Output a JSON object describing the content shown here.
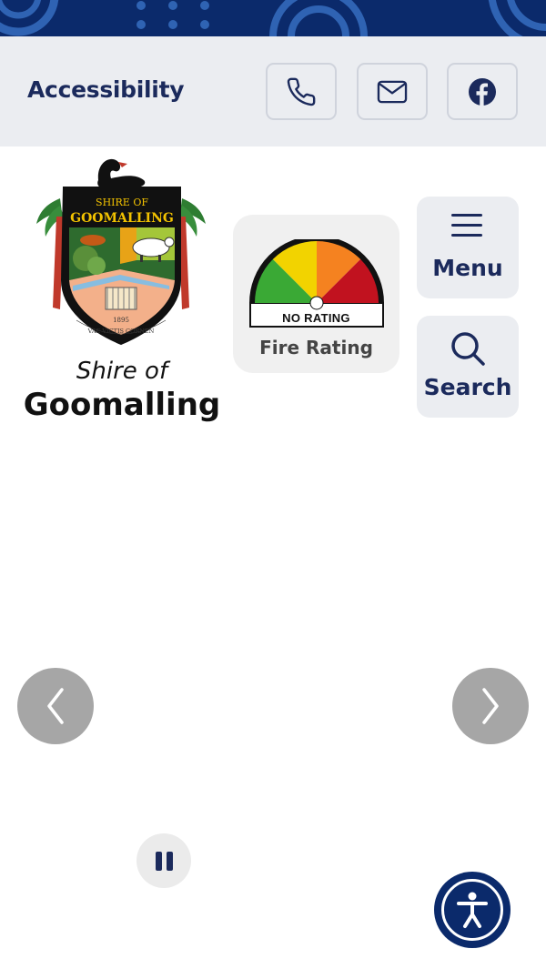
{
  "header": {
    "accessibility_label": "Accessibility",
    "contact_icons": [
      "phone-icon",
      "mail-icon",
      "facebook-icon"
    ]
  },
  "logo": {
    "crest_text_top": "SHIRE OF",
    "crest_text_name": "GOOMALLING",
    "crest_year": "1895",
    "crest_motto": "VAE VICTIS CORNEN",
    "wordmark_line1": "Shire of",
    "wordmark_line2": "Goomalling"
  },
  "fire": {
    "gauge_status": "NO RATING",
    "title": "Fire Rating",
    "segment_colors": [
      "#3aa935",
      "#f2d300",
      "#f58220",
      "#c1121f"
    ]
  },
  "nav": {
    "menu_label": "Menu",
    "search_label": "Search"
  },
  "slider": {
    "prev_icon": "chevron-left-icon",
    "next_icon": "chevron-right-icon",
    "pause_icon": "pause-icon"
  },
  "colors": {
    "brand_navy": "#0b2a6b",
    "text_navy": "#1b2a5c",
    "topbar_bg": "#ebedf1"
  }
}
